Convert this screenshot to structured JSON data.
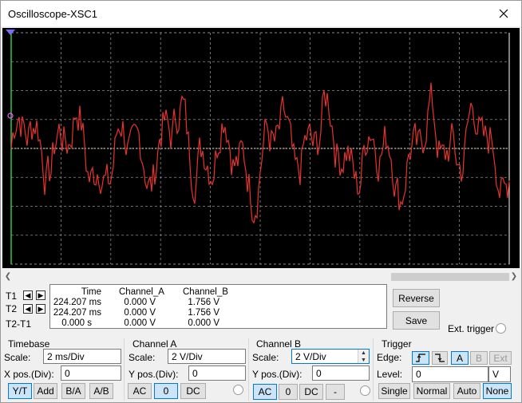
{
  "window": {
    "title": "Oscilloscope-XSC1"
  },
  "colors": {
    "trace_a": "#e8322e",
    "trace_b": "#f4e3c3",
    "grid": "#8c8c8c",
    "screen_bg": "#000000",
    "border_green": "#2ecc40",
    "accent": "#0078d7"
  },
  "cursors": {
    "t1": "T1",
    "t2": "T2",
    "t2t1": "T2-T1"
  },
  "measurements": {
    "headers": {
      "time": "Time",
      "channel_a": "Channel_A",
      "channel_b": "Channel_B"
    },
    "rows": [
      {
        "time": "224.207 ms",
        "a": "0.000 V",
        "b": "1.756 V"
      },
      {
        "time": "224.207 ms",
        "a": "0.000 V",
        "b": "1.756 V"
      },
      {
        "time": "0.000 s",
        "a": "0.000 V",
        "b": "0.000 V"
      }
    ]
  },
  "actions": {
    "reverse": "Reverse",
    "save": "Save",
    "ext_trigger": "Ext. trigger"
  },
  "timebase": {
    "title": "Timebase",
    "scale_label": "Scale:",
    "scale": "2 ms/Div",
    "xpos_label": "X pos.(Div):",
    "xpos": "0",
    "buttons": [
      "Y/T",
      "Add",
      "B/A",
      "A/B"
    ],
    "active": "Y/T"
  },
  "channel_a": {
    "title": "Channel A",
    "scale_label": "Scale:",
    "scale": "2  V/Div",
    "ypos_label": "Y pos.(Div):",
    "ypos": "0",
    "buttons": [
      "AC",
      "0",
      "DC"
    ],
    "active": "0"
  },
  "channel_b": {
    "title": "Channel B",
    "scale_label": "Scale:",
    "scale": "2  V/Div",
    "ypos_label": "Y pos.(Div):",
    "ypos": "0",
    "buttons": [
      "AC",
      "0",
      "DC",
      "-"
    ],
    "active": "AC"
  },
  "trigger": {
    "title": "Trigger",
    "edge_label": "Edge:",
    "level_label": "Level:",
    "level": "0",
    "level_unit": "V",
    "edge_buttons": [
      "A",
      "B",
      "Ext"
    ],
    "edge_active": "A",
    "modes": [
      "Single",
      "Normal",
      "Auto",
      "None"
    ],
    "mode_active": "None"
  }
}
